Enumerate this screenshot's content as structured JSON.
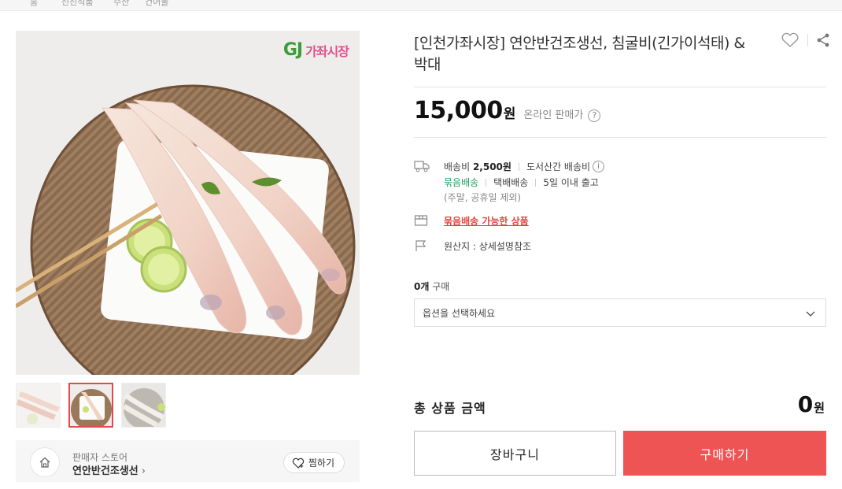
{
  "breadcrumb": [
    "홈",
    "신선식품",
    "수산",
    "건어물"
  ],
  "gallery": {
    "logo": {
      "mark": "GJ",
      "name": "가좌시장"
    },
    "thumb_count": 3,
    "active_thumb": 2
  },
  "seller": {
    "label": "판매자 스토어",
    "name": "연안반건조생선",
    "chevron": "›",
    "favorite_label": "찜하기"
  },
  "product": {
    "title": "[인천가좌시장] 연안반건조생선, 침굴비(긴가이석태) & 박대",
    "price": "15,000",
    "currency": "원",
    "price_note": "온라인 판매가",
    "help": "?"
  },
  "shipping": {
    "fee_label": "배송비",
    "fee": "2,500원",
    "island_label": "도서산간 배송비",
    "info": "i",
    "bundle": "묶음배송",
    "courier": "택배배송",
    "lead": "5일 이내 출고",
    "note": "(주말, 공휴일 제외)"
  },
  "bundle_link": "묶음배송 가능한 상품",
  "origin": "원산지 : 상세설명참조",
  "purchase": {
    "qty_num": "0개",
    "qty_label": "구매",
    "select_placeholder": "옵션을 선택하세요"
  },
  "total": {
    "label": "총 상품 금액",
    "value": "0",
    "currency": "원"
  },
  "buttons": {
    "cart": "장바구니",
    "buy": "구매하기"
  },
  "colors": {
    "accent": "#ef5455",
    "green": "#1e9e65",
    "link_red": "#e0463f"
  }
}
